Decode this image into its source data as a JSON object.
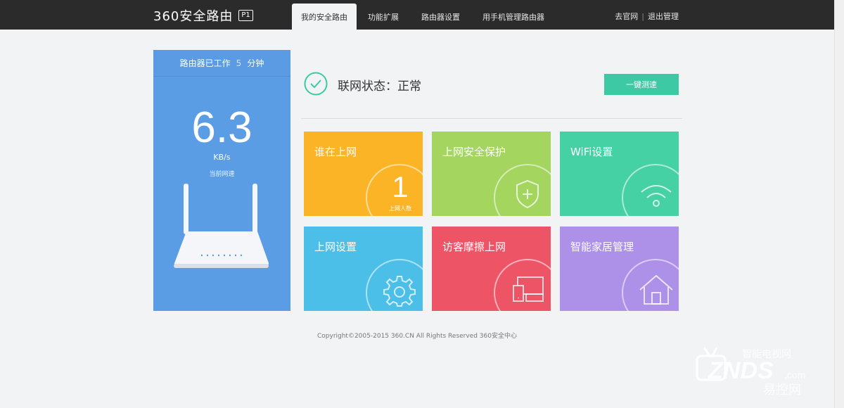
{
  "header": {
    "logo_text": "360安全路由",
    "logo_badge": "P1",
    "tabs": [
      {
        "label": "我的安全路由",
        "active": true
      },
      {
        "label": "功能扩展",
        "active": false
      },
      {
        "label": "路由器设置",
        "active": false
      },
      {
        "label": "用手机管理路由器",
        "active": false
      }
    ],
    "links": {
      "official_site": "去官网",
      "logout": "退出管理"
    }
  },
  "speed_panel": {
    "uptime_prefix": "路由器已工作",
    "uptime_value": "5",
    "uptime_unit": "分钟",
    "speed_value": "6.3",
    "speed_unit": "KB/s",
    "speed_caption": "当前网速"
  },
  "status": {
    "label": "联网状态：正常",
    "speedtest_button": "一键测速"
  },
  "tiles": [
    {
      "title": "谁在上网",
      "icon": "count",
      "count": "1",
      "count_label": "上网人数",
      "color": "#fbb425"
    },
    {
      "title": "上网安全保护",
      "icon": "shield-plus-icon",
      "color": "#a3d55f"
    },
    {
      "title": "WiFi设置",
      "icon": "wifi-icon",
      "color": "#46d1a5"
    },
    {
      "title": "上网设置",
      "icon": "gear-icon",
      "color": "#4bbfe7"
    },
    {
      "title": "访客摩擦上网",
      "icon": "devices-icon",
      "color": "#ed5466"
    },
    {
      "title": "智能家居管理",
      "icon": "home-icon",
      "color": "#ad90e8"
    }
  ],
  "colors": {
    "topbar": "#2b2b2b",
    "panel_blue": "#5b9de5",
    "accent_green": "#3dc9a3"
  },
  "footer": {
    "copyright": "Copyright©2005-2015 360.CN All Rights Reserved 360安全中心"
  },
  "watermark": {
    "text_top": "智能电视网",
    "text_logo": "ZNDS",
    "text_com": ".com",
    "text_bottom": "易控网"
  }
}
